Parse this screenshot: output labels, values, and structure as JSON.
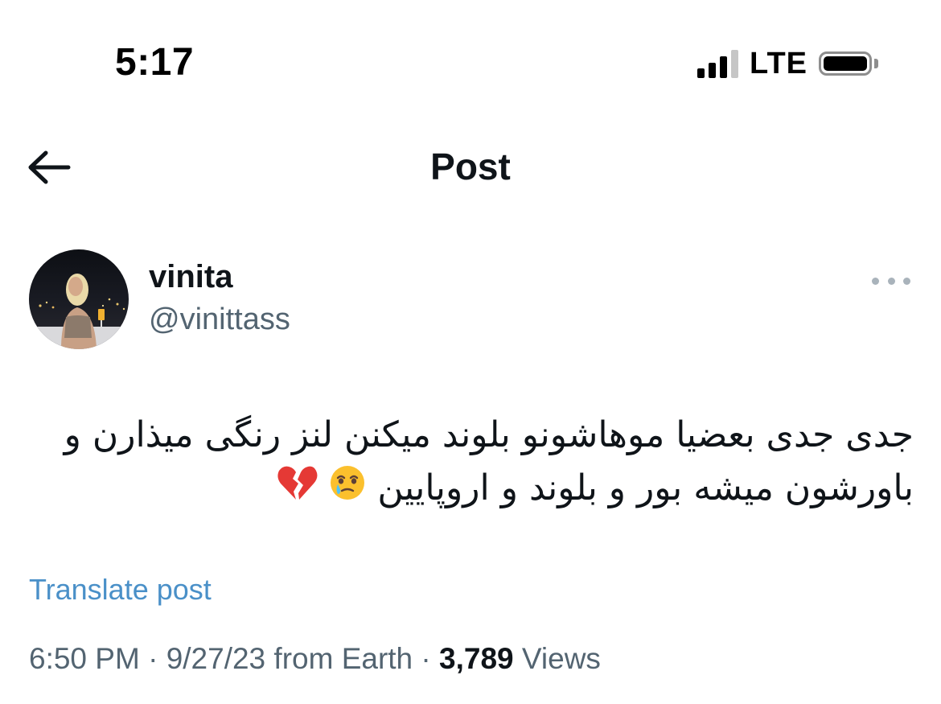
{
  "status_bar": {
    "time": "5:17",
    "network": "LTE"
  },
  "header": {
    "title": "Post",
    "back_icon": "arrow-left-icon"
  },
  "author": {
    "display_name": "vinita",
    "handle": "@vinittass",
    "more_icon": "more-horizontal-icon"
  },
  "post": {
    "line1": "جدی جدی بعضیا موهاشونو بلوند میکنن لنز رنگی میذارن و",
    "line2": "باورشون میشه بور و بلوند و اروپایین",
    "emojis": [
      "face-holding-back-tears",
      "broken-heart"
    ],
    "translate_label": "Translate post"
  },
  "meta": {
    "time": "6:50 PM",
    "sep1": " · ",
    "date": "9/27/23",
    "source": " from Earth",
    "sep2": " · ",
    "views_count": "3,789",
    "views_label": " Views"
  },
  "colors": {
    "text_primary": "#0f1419",
    "text_secondary": "#536471",
    "link": "#4a90c8"
  }
}
